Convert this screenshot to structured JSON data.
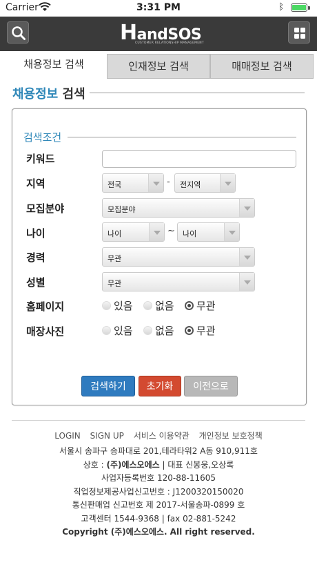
{
  "status": {
    "carrier": "Carrier",
    "time": "3:31 PM"
  },
  "header": {
    "logo_main": "andSOS",
    "logo_h": "H",
    "logo_sub": "CUSTOMER RELATIONSHIP MANAGEMENT"
  },
  "tabs": [
    {
      "label": "채용정보 검색",
      "active": true
    },
    {
      "label": "인재정보 검색",
      "active": false
    },
    {
      "label": "매매정보 검색",
      "active": false
    }
  ],
  "section": {
    "title_accent": "채용정보",
    "title_rest": " 검색"
  },
  "form": {
    "condition_title": "검색조건",
    "keyword": {
      "label": "키워드",
      "value": ""
    },
    "region": {
      "label": "지역",
      "select1": "전국",
      "separator": "-",
      "select2": "전지역"
    },
    "field": {
      "label": "모집분야",
      "select": "모집분야"
    },
    "age": {
      "label": "나이",
      "select1": "나이",
      "separator": "~",
      "select2": "나이"
    },
    "career": {
      "label": "경력",
      "select": "무관"
    },
    "gender": {
      "label": "성별",
      "select": "무관"
    },
    "homepage": {
      "label": "홈페이지",
      "options": [
        "있음",
        "없음",
        "무관"
      ],
      "selected": "무관"
    },
    "store_photo": {
      "label": "매장사진",
      "options": [
        "있음",
        "없음",
        "무관"
      ],
      "selected": "무관"
    }
  },
  "buttons": {
    "search": "검색하기",
    "reset": "초기화",
    "back": "이전으로"
  },
  "footer": {
    "links": [
      "LOGIN",
      "SIGN UP",
      "서비스 이용약관",
      "개인정보 보호정책"
    ],
    "address": "서울시 송파구 송파대로 201,테라타워2 A동 910,911호",
    "company_prefix": "상호 : ",
    "company_name": "(주)에스오에스",
    "company_suffix": " | 대표 신봉웅,오상록",
    "biz_no": "사업자등록번호 120-88-11605",
    "job_info_no": "직업정보제공사업신고번호 : J1200320150020",
    "mail_order_no": "통신판매업 신고번호 제 2017-서울송파-0899 호",
    "contact": "고객센터 1544-9368 | fax 02-881-5242",
    "copyright": "Copyright (주)에스오에스. All right reserved."
  },
  "colors": {
    "accent": "#2e87b8",
    "header_bg": "#3a3a3a",
    "search_btn": "#2f7bbf",
    "reset_btn": "#d34a30",
    "back_btn": "#b8b8b8"
  }
}
